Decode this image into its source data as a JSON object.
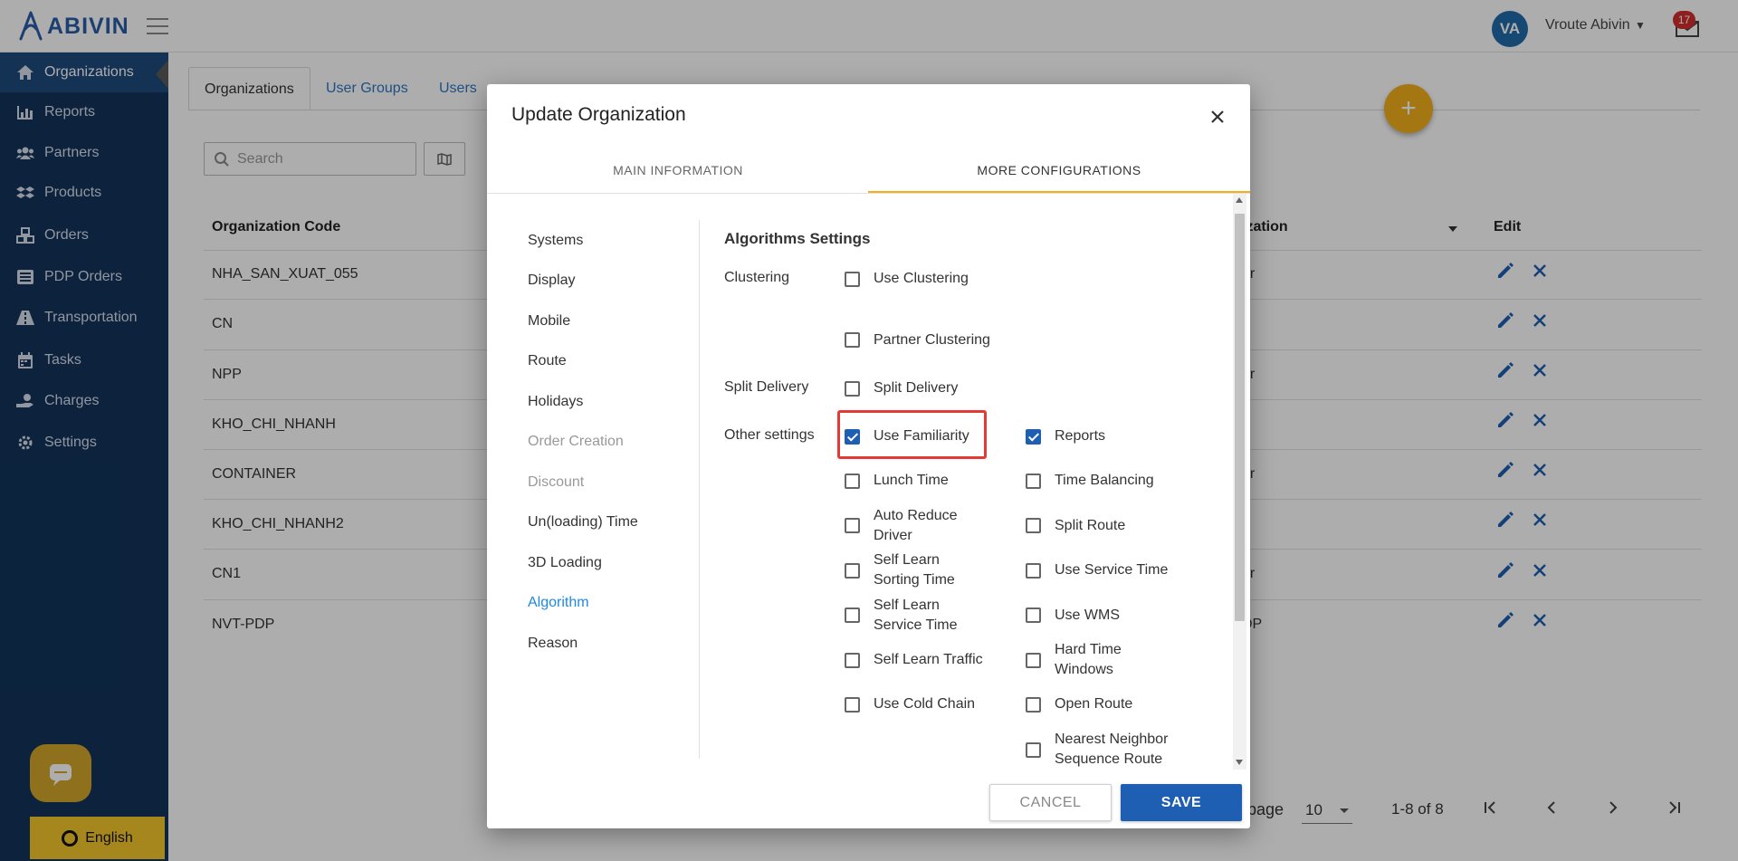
{
  "app": {
    "brand": "ABIVIN",
    "user_initials": "VA",
    "user_name": "Vroute Abivin",
    "notification_count": "17"
  },
  "sidebar": {
    "items": [
      {
        "label": "Organizations",
        "icon": "home-icon"
      },
      {
        "label": "Reports",
        "icon": "bar-chart-icon"
      },
      {
        "label": "Partners",
        "icon": "users-icon"
      },
      {
        "label": "Products",
        "icon": "dropbox-icon"
      },
      {
        "label": "Orders",
        "icon": "cubes-icon"
      },
      {
        "label": "PDP Orders",
        "icon": "list-icon"
      },
      {
        "label": "Transportation",
        "icon": "road-icon"
      },
      {
        "label": "Tasks",
        "icon": "calendar-icon"
      },
      {
        "label": "Charges",
        "icon": "hand-money-icon"
      },
      {
        "label": "Settings",
        "icon": "gear-icon"
      }
    ],
    "active": "Organizations",
    "language": "English"
  },
  "page": {
    "tabs": [
      "Organizations",
      "User Groups",
      "Users"
    ],
    "search_placeholder": "Search",
    "table": {
      "columns": {
        "code": "Organization Code",
        "parent_partial": "ization",
        "edit": "Edit"
      },
      "rows": [
        {
          "code": "NHA_SAN_XUAT_055",
          "tail": "er"
        },
        {
          "code": "CN",
          "tail": ""
        },
        {
          "code": "NPP",
          "tail": "er"
        },
        {
          "code": "KHO_CHI_NHANH",
          "tail": ""
        },
        {
          "code": "CONTAINER",
          "tail": "er"
        },
        {
          "code": "KHO_CHI_NHANH2",
          "tail": ""
        },
        {
          "code": "CN1",
          "tail": "er"
        },
        {
          "code": "NVT-PDP",
          "tail": "DP"
        }
      ]
    },
    "pager": {
      "label_partial": "page",
      "per_page": "10",
      "range": "1-8 of 8"
    }
  },
  "modal": {
    "title": "Update Organization",
    "tabs": {
      "main": "MAIN INFORMATION",
      "more": "MORE CONFIGURATIONS"
    },
    "menu": {
      "systems": "Systems",
      "display": "Display",
      "mobile": "Mobile",
      "route": "Route",
      "holidays": "Holidays",
      "order_creation": "Order Creation",
      "discount": "Discount",
      "unloading_time": "Un(loading) Time",
      "loading_3d": "3D Loading",
      "algorithm": "Algorithm",
      "reason": "Reason"
    },
    "section_title": "Algorithms Settings",
    "groups": {
      "clustering": "Clustering",
      "split_delivery": "Split Delivery",
      "other_settings": "Other settings"
    },
    "options": {
      "use_clustering": {
        "label": "Use Clustering",
        "checked": false
      },
      "partner_clustering": {
        "label": "Partner Clustering",
        "checked": false
      },
      "split_delivery": {
        "label": "Split Delivery",
        "checked": false
      },
      "use_familiarity": {
        "label": "Use Familiarity",
        "checked": true
      },
      "reports": {
        "label": "Reports",
        "checked": true
      },
      "lunch_time": {
        "label": "Lunch Time",
        "checked": false
      },
      "time_balancing": {
        "label": "Time Balancing",
        "checked": false
      },
      "auto_reduce_driver_1": {
        "label": "Auto Reduce",
        "checked": false
      },
      "auto_reduce_driver_2": "Driver",
      "split_route": {
        "label": "Split Route",
        "checked": false
      },
      "self_learn_sorting_1": {
        "label": "Self Learn",
        "checked": false
      },
      "self_learn_sorting_2": "Sorting Time",
      "use_service_time": {
        "label": "Use Service Time",
        "checked": false
      },
      "self_learn_service_1": {
        "label": "Self Learn",
        "checked": false
      },
      "self_learn_service_2": "Service Time",
      "use_wms": {
        "label": "Use WMS",
        "checked": false
      },
      "self_learn_traffic": {
        "label": "Self Learn Traffic",
        "checked": false
      },
      "hard_time_windows_1": {
        "label": "Hard Time",
        "checked": false
      },
      "hard_time_windows_2": "Windows",
      "use_cold_chain": {
        "label": "Use Cold Chain",
        "checked": false
      },
      "open_route": {
        "label": "Open Route",
        "checked": false
      },
      "nearest_neighbor_1": {
        "label": "Nearest Neighbor",
        "checked": false
      },
      "nearest_neighbor_2": "Sequence Route"
    },
    "buttons": {
      "cancel": "CANCEL",
      "save": "SAVE"
    }
  },
  "colors": {
    "sidebar_bg": "#12335b",
    "accent_blue": "#1e5fb3",
    "accent_yellow": "#f2b01b",
    "highlight_red": "#e53935"
  }
}
